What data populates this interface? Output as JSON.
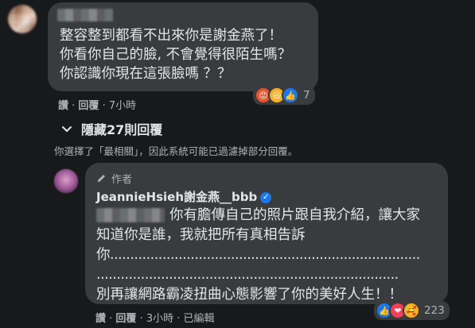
{
  "comment1": {
    "lines": [
      "整容整到都看不出來你是謝金燕了！",
      "你看你自己的臉, 不會覺得很陌生嗎？",
      "你認識你現在這張臉嗎 ？？"
    ],
    "reaction_icons": [
      "angry-icon",
      "haha-icon",
      "like-icon"
    ],
    "reaction_count": "7",
    "actions": {
      "like": "讚",
      "reply": "回覆",
      "time": "7小時"
    }
  },
  "hidden_replies": {
    "label": "隱藏27則回覆"
  },
  "filter_note": "你選擇了「最相關」，因此系統可能已過濾掉部分回覆。",
  "reply": {
    "badge": "作者",
    "author": "JeannieHsieh謝金燕__bbb",
    "lines": [
      "你有膽傳自己的照片跟自我介紹，讓大家",
      "知道你是誰，我就把所有真相告訴",
      "你.............................................................................",
      "...........................................................................",
      "別再讓網路霸凌扭曲心態影響了你的美好人生！！"
    ],
    "reaction_icons": [
      "like-icon",
      "love-icon",
      "care-icon"
    ],
    "reaction_count": "223",
    "actions": {
      "like": "讚",
      "reply": "回覆",
      "time": "3小時",
      "edited": "已編輯"
    }
  },
  "colors": {
    "background": "#18191a",
    "bubble": "#3a3b3c",
    "text": "#e4e6eb",
    "muted": "#b0b3b8",
    "like": "#1877f2",
    "love": "#f33e58",
    "angry": "#e8542c",
    "haha": "#f7b125"
  }
}
